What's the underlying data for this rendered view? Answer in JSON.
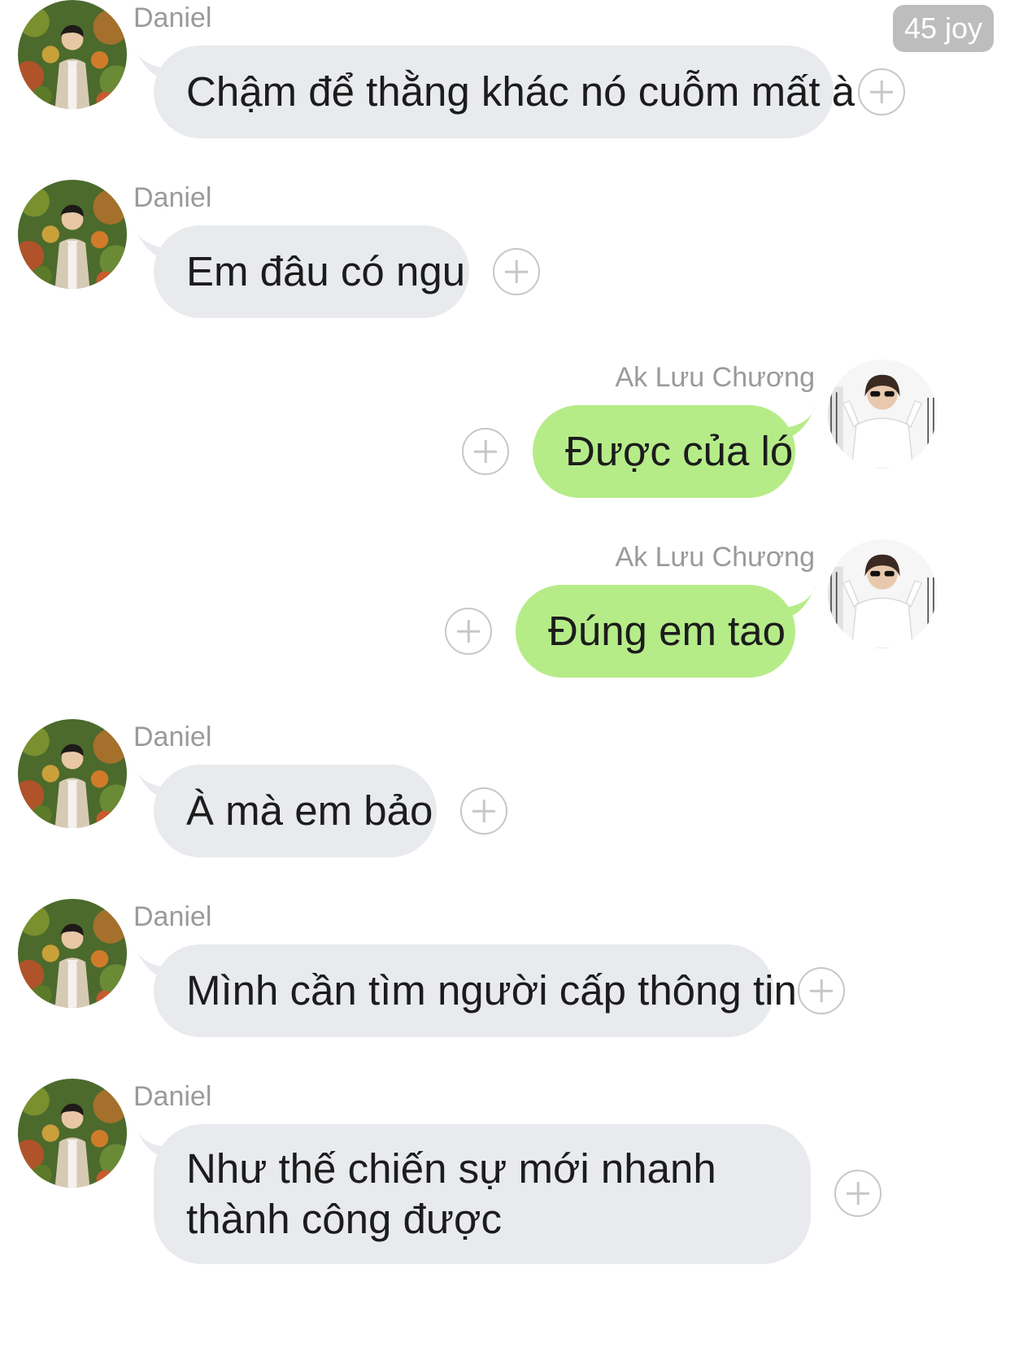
{
  "header": {
    "badge": "45 joy"
  },
  "messages": [
    {
      "sender": "Daniel",
      "text": "Chậm để thằng khác nó cuỗm mất à",
      "direction": "incoming"
    },
    {
      "sender": "Daniel",
      "text": "Em đâu có ngu",
      "direction": "incoming"
    },
    {
      "sender": "Ak Lưu Chương",
      "text": "Được của ló",
      "direction": "outgoing"
    },
    {
      "sender": "Ak Lưu Chương",
      "text": "Đúng em tao",
      "direction": "outgoing"
    },
    {
      "sender": "Daniel",
      "text": "À mà em bảo",
      "direction": "incoming"
    },
    {
      "sender": "Daniel",
      "text": "Mình cần tìm người cấp thông tin",
      "direction": "incoming"
    },
    {
      "sender": "Daniel",
      "text": "Như thế chiến sự mới nhanh thành công được",
      "direction": "incoming"
    }
  ],
  "colors": {
    "incoming_bubble": "#e8eaed",
    "outgoing_bubble": "#b5ec88",
    "sender_name": "#9a9a9a",
    "badge_bg": "#bdbdbd",
    "plus_icon": "#c7c7c7"
  },
  "icons": {
    "reaction": "plus-circle-icon",
    "avatar_incoming": "avatar-photo-daniel",
    "avatar_outgoing": "avatar-photo-ak-luu-chuong"
  }
}
